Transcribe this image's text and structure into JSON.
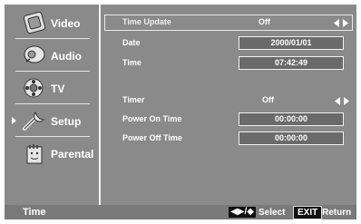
{
  "sidebar": {
    "items": [
      {
        "label": "Video",
        "icon": "video-icon",
        "selected": false
      },
      {
        "label": "Audio",
        "icon": "audio-icon",
        "selected": false
      },
      {
        "label": "TV",
        "icon": "tv-icon",
        "selected": false
      },
      {
        "label": "Setup",
        "icon": "setup-icon",
        "selected": true
      },
      {
        "label": "Parental",
        "icon": "parental-icon",
        "selected": false
      }
    ]
  },
  "settings": {
    "time_update": {
      "label": "Time Update",
      "value": "Off"
    },
    "date": {
      "label": "Date",
      "value": "2000/01/01"
    },
    "time": {
      "label": "Time",
      "value": "07:42:49"
    },
    "timer": {
      "label": "Timer",
      "value": "Off"
    },
    "power_on_time": {
      "label": "Power On Time",
      "value": "00:00:00"
    },
    "power_off_time": {
      "label": "Power Off Time",
      "value": "00:00:00"
    }
  },
  "footer": {
    "title": "Time",
    "nav_keys": "◀▶/◆",
    "select_label": "Select",
    "exit_key": "EXIT",
    "return_label": "Return"
  },
  "colors": {
    "background": "#8a8a8a",
    "footer": "#7a7a7a",
    "value_box": "#6a6a6a",
    "text": "#ffffff"
  }
}
